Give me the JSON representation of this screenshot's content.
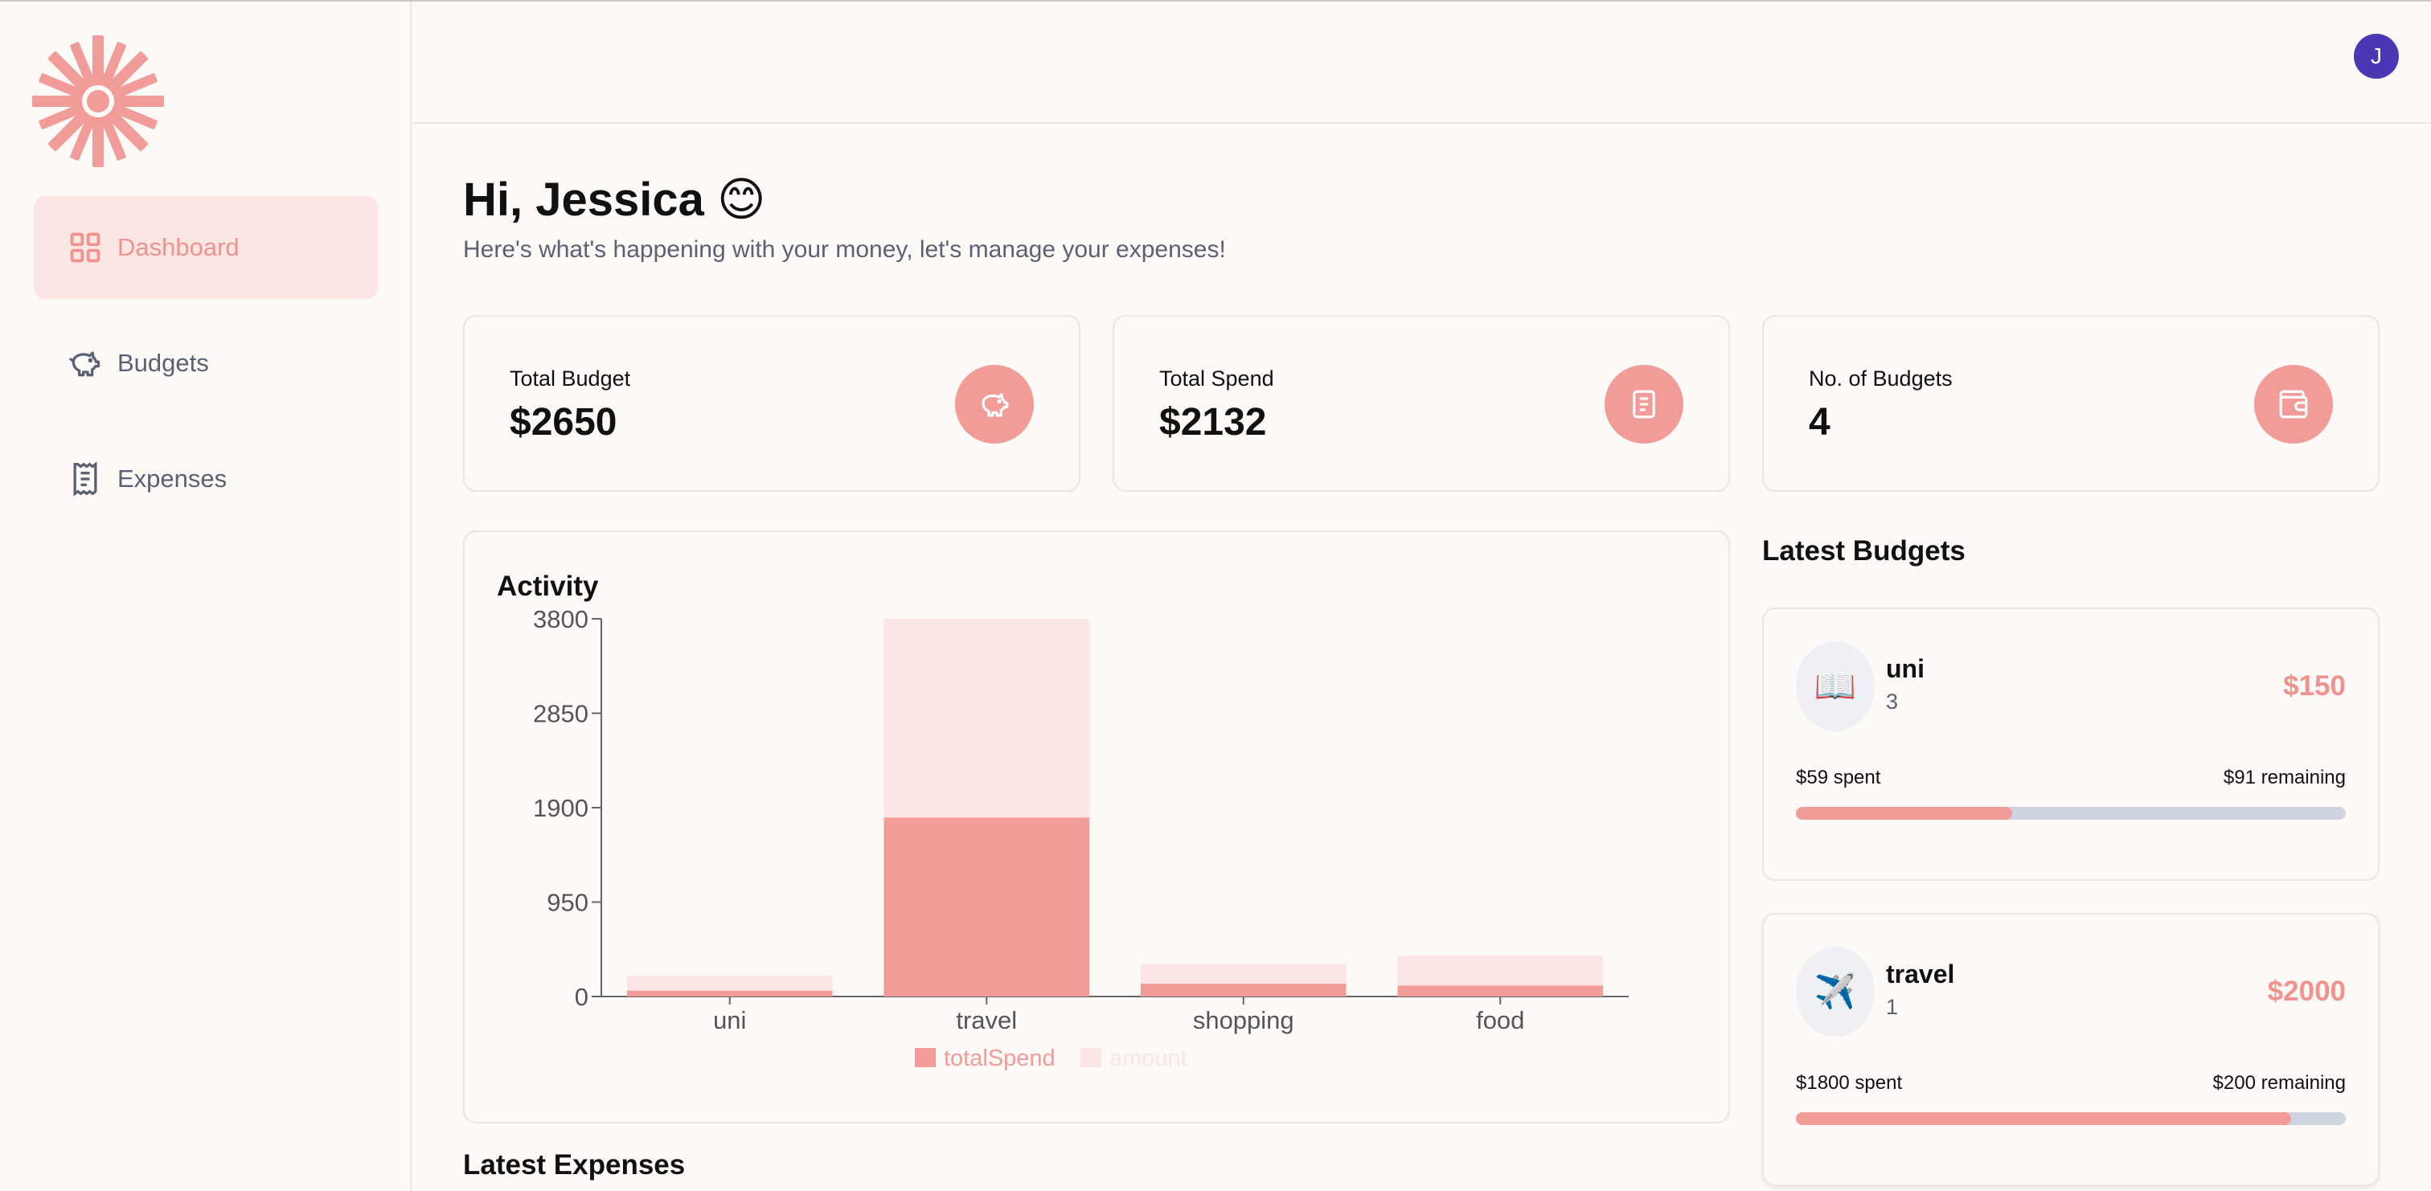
{
  "nav": {
    "items": [
      {
        "label": "Dashboard",
        "icon": "grid-icon",
        "active": true
      },
      {
        "label": "Budgets",
        "icon": "piggy-bank-icon",
        "active": false
      },
      {
        "label": "Expenses",
        "icon": "receipt-icon",
        "active": false
      }
    ]
  },
  "user": {
    "avatar_initial": "J"
  },
  "greeting": {
    "title": "Hi, Jessica 😊",
    "subtitle": "Here's what's happening with your money, let's manage your expenses!"
  },
  "stats": [
    {
      "label": "Total Budget",
      "value": "$2650",
      "icon": "piggy-bank-icon"
    },
    {
      "label": "Total Spend",
      "value": "$2132",
      "icon": "receipt-icon"
    },
    {
      "label": "No. of Budgets",
      "value": "4",
      "icon": "wallet-icon"
    }
  ],
  "activity": {
    "title": "Activity"
  },
  "chart_data": {
    "type": "bar",
    "stacked": true,
    "title": "Activity",
    "categories": [
      "uni",
      "travel",
      "shopping",
      "food"
    ],
    "series": [
      {
        "name": "totalSpend",
        "values": [
          59,
          1800,
          130,
          110
        ],
        "color": "#f19c98"
      },
      {
        "name": "amount",
        "values": [
          150,
          2000,
          200,
          300
        ],
        "color": "#fbe6e4"
      }
    ],
    "yticks": [
      "0",
      "950",
      "1900",
      "2850",
      "3800"
    ],
    "ylim": [
      0,
      3800
    ],
    "legend": "bottom-center",
    "grid": false
  },
  "latest_expenses": {
    "title": "Latest Expenses"
  },
  "latest_budgets": {
    "title": "Latest Budgets",
    "items": [
      {
        "emoji": "📖",
        "name": "uni",
        "count": "3",
        "amount": "$150",
        "spent": "$59 spent",
        "remaining": "$91 remaining",
        "progress": 0.393
      },
      {
        "emoji": "✈️",
        "name": "travel",
        "count": "1",
        "amount": "$2000",
        "spent": "$1800 spent",
        "remaining": "$200 remaining",
        "progress": 0.9
      }
    ]
  },
  "colors": {
    "accent": "#f19c98",
    "accent_light": "#fbe6e4",
    "avatar": "#4b36b3",
    "muted_text": "#5b6075"
  }
}
